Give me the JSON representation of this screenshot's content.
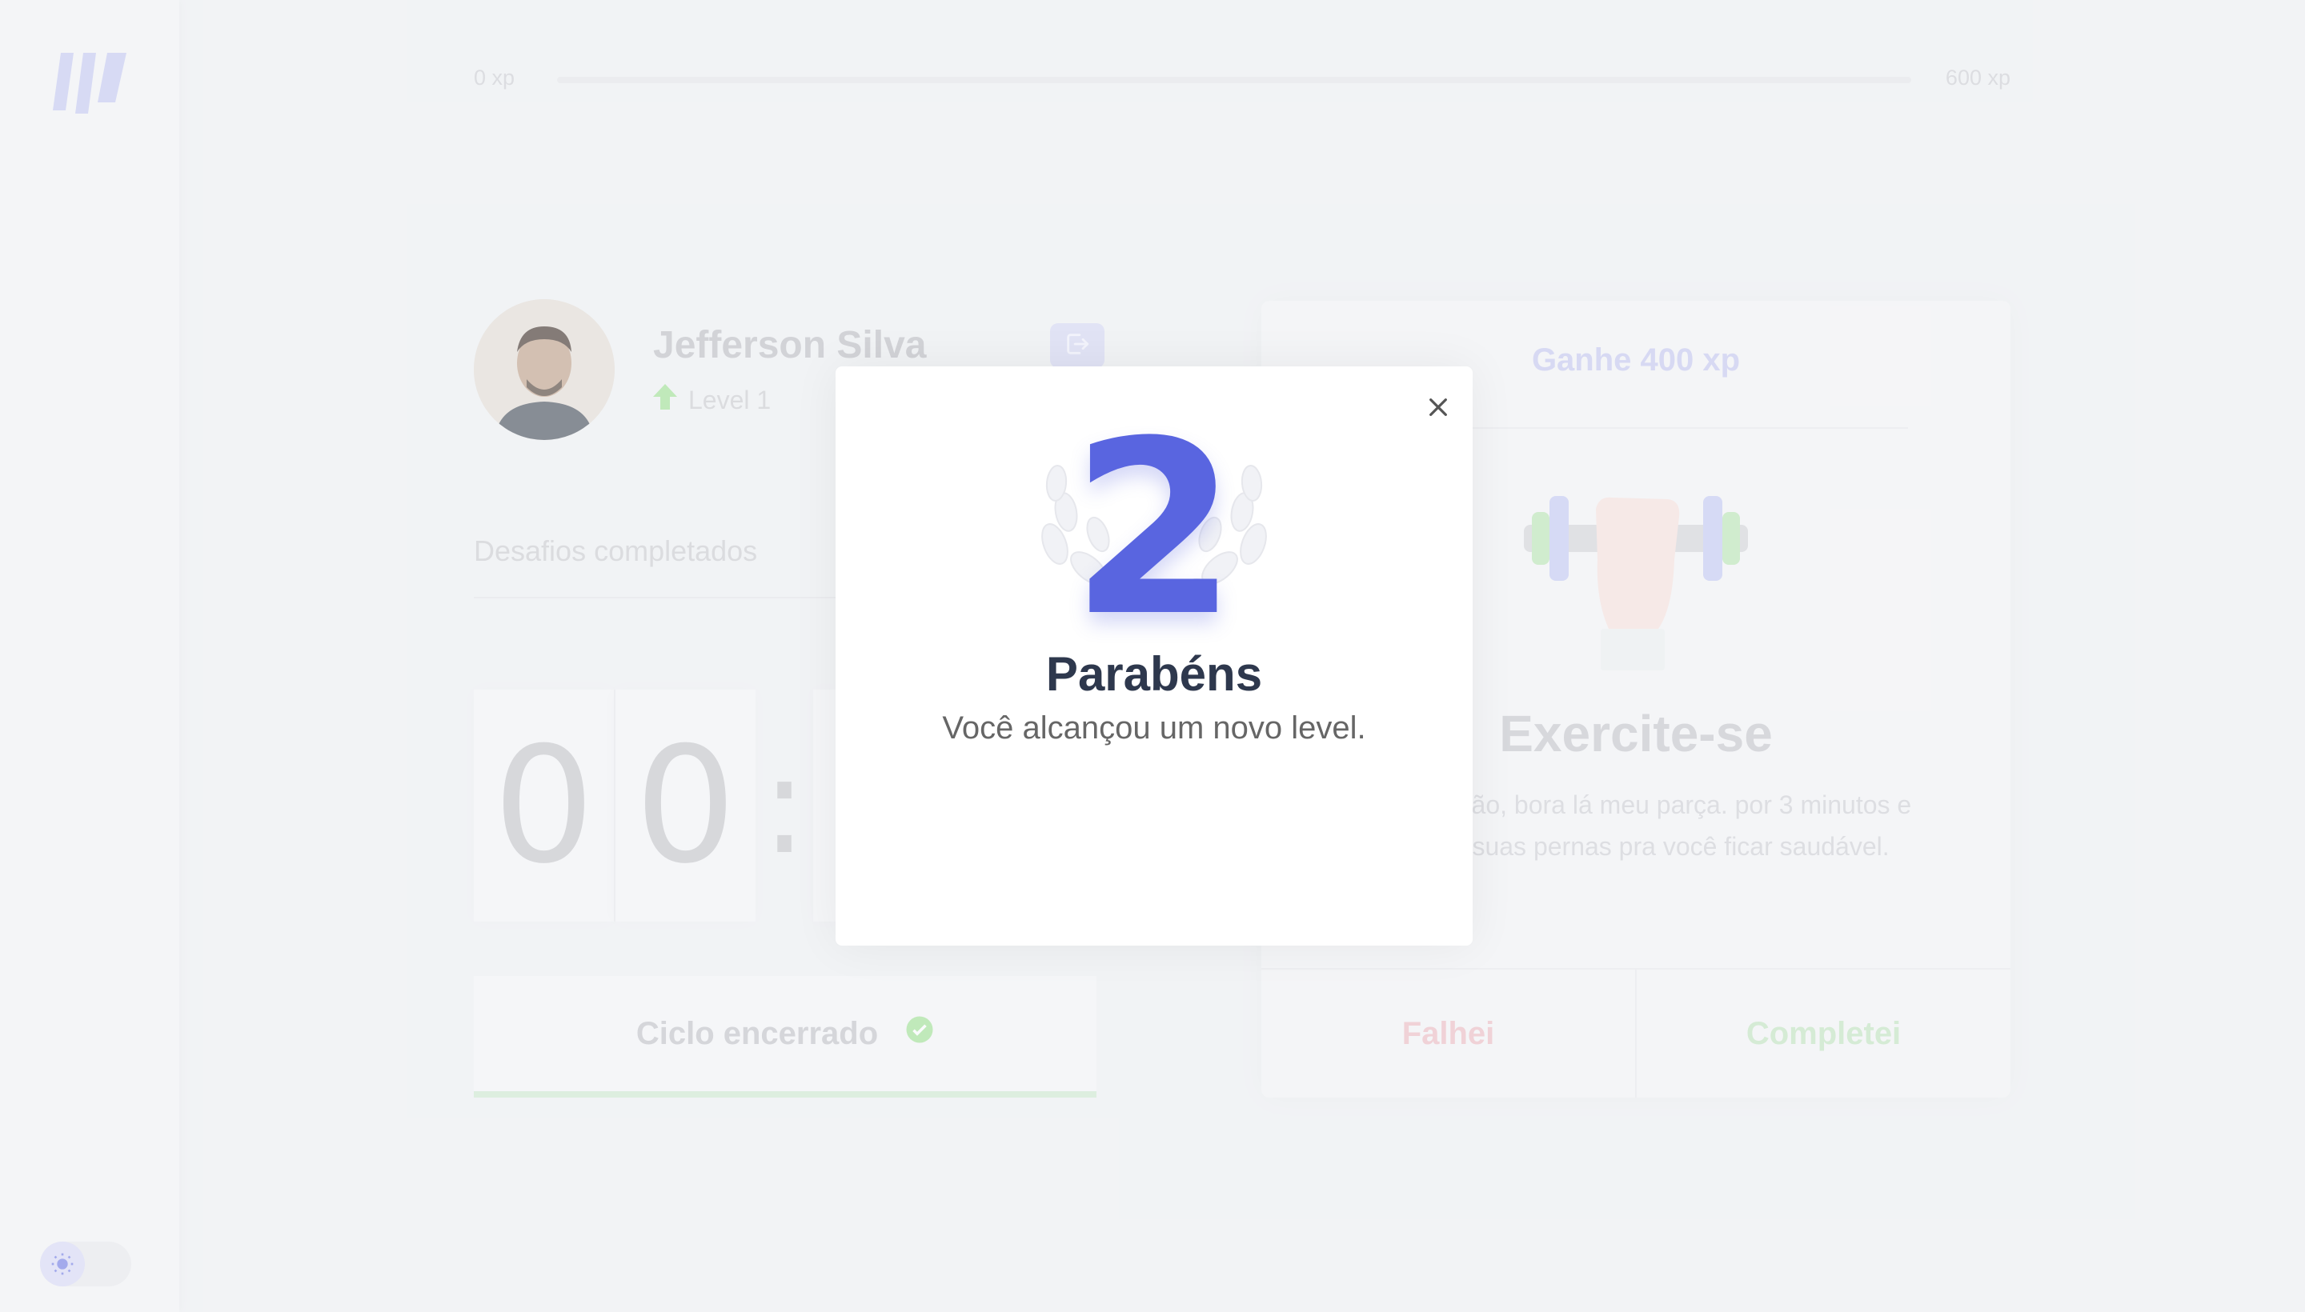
{
  "xp": {
    "min_label": "0 xp",
    "max_label": "600 xp",
    "progress": 0
  },
  "profile": {
    "name": "Jefferson Silva",
    "level_label": "Level 1"
  },
  "challenges": {
    "label": "Desafios completados"
  },
  "countdown": {
    "minutes_tens": "0",
    "minutes_ones": "0",
    "separator": ":"
  },
  "cycle": {
    "label": "Ciclo encerrado"
  },
  "challenge_card": {
    "header": "Ganhe 400 xp",
    "title": "Exercite-se",
    "description": "gora Diegão, bora lá meu parça. por 3 minutos e estique suas pernas pra você ficar saudável.",
    "fail_label": "Falhei",
    "done_label": "Completei"
  },
  "modal": {
    "level": "2",
    "title": "Parabéns",
    "text": "Você alcançou um novo level."
  },
  "colors": {
    "accent": "#5965e0",
    "success": "#4cd62b",
    "danger": "#e83f5b",
    "background": "#f2f3f5"
  },
  "icons": {
    "logo": "brand-logo-icon",
    "logout": "logout-icon",
    "level_up": "arrow-up-icon",
    "check": "check-circle-icon",
    "close": "close-icon",
    "theme": "sun-icon"
  }
}
